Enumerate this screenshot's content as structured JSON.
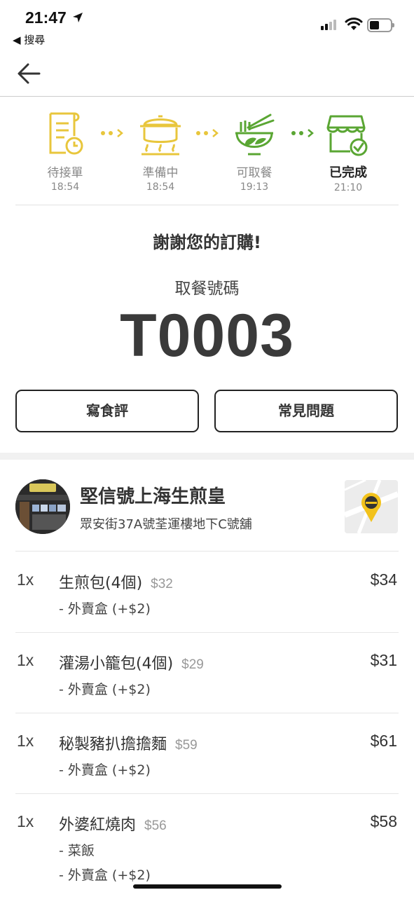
{
  "status": {
    "time": "21:47",
    "back_app_label": "◀ 搜尋"
  },
  "colors": {
    "yellow": "#e8c63c",
    "green": "#5aa633",
    "text": "#333333"
  },
  "progress": {
    "steps": [
      {
        "label": "待接單",
        "time": "18:54",
        "icon": "order-list-clock-icon",
        "color": "#e8c63c"
      },
      {
        "label": "準備中",
        "time": "18:54",
        "icon": "cooking-pot-icon",
        "color": "#e8c63c"
      },
      {
        "label": "可取餐",
        "time": "19:13",
        "icon": "noodle-bowl-icon",
        "color": "#5aa633"
      },
      {
        "label": "已完成",
        "time": "21:10",
        "icon": "store-check-icon",
        "color": "#5aa633"
      }
    ]
  },
  "thanks": "謝謝您的訂購!",
  "pickup": {
    "label": "取餐號碼",
    "number": "T0003"
  },
  "buttons": {
    "review": "寫食評",
    "faq": "常見問題"
  },
  "restaurant": {
    "name": "堅信號上海生煎皇",
    "address": "眾安街37A號荃運樓地下C號舖"
  },
  "items": [
    {
      "qty": "1x",
      "name": "生煎包(4個)",
      "unit_price": "$32",
      "price": "$34",
      "options": [
        "- 外賣盒 (+$2)"
      ]
    },
    {
      "qty": "1x",
      "name": "灌湯小籠包(4個)",
      "unit_price": "$29",
      "price": "$31",
      "options": [
        "- 外賣盒 (+$2)"
      ]
    },
    {
      "qty": "1x",
      "name": "秘製豬扒擔擔麵",
      "unit_price": "$59",
      "price": "$61",
      "options": [
        "- 外賣盒 (+$2)"
      ]
    },
    {
      "qty": "1x",
      "name": "外婆紅燒肉",
      "unit_price": "$56",
      "price": "$58",
      "options": [
        "- 菜飯",
        "- 外賣盒 (+$2)"
      ]
    }
  ]
}
